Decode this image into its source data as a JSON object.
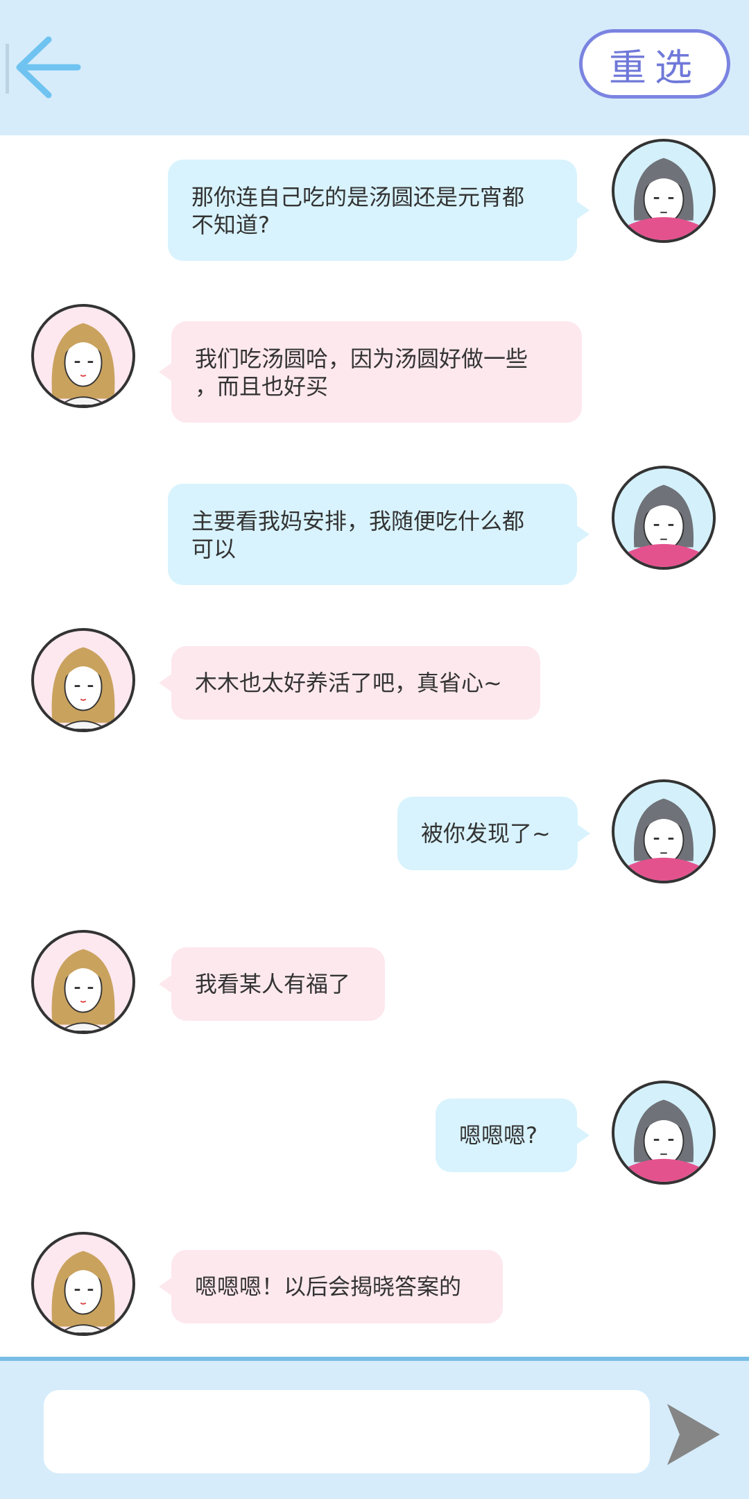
{
  "header": {
    "back_icon": "arrow-left-icon",
    "reselect_label": "重选",
    "colors": {
      "background": "#d6ecfb",
      "back_arrow": "#6fc3f0",
      "reselect": "#6f78d8"
    }
  },
  "messages": [
    {
      "side": "right",
      "lines": [
        "那你连自己吃的是汤圆还是元宵都",
        "不知道?"
      ]
    },
    {
      "side": "left",
      "lines": [
        "我们吃汤圆哈，因为汤圆好做一些",
        "，而且也好买"
      ]
    },
    {
      "side": "right",
      "lines": [
        "主要看我妈安排，我随便吃什么都",
        "可以"
      ]
    },
    {
      "side": "left",
      "lines": [
        "木木也太好养活了吧，真省心~"
      ]
    },
    {
      "side": "right",
      "lines": [
        "被你发现了~"
      ]
    },
    {
      "side": "left",
      "lines": [
        "我看某人有福了"
      ]
    },
    {
      "side": "right",
      "lines": [
        "嗯嗯嗯?"
      ]
    },
    {
      "side": "left",
      "lines": [
        "嗯嗯嗯！以后会揭晓答案的"
      ]
    }
  ],
  "composer": {
    "input_value": "",
    "input_placeholder": "",
    "send_icon": "send-icon"
  },
  "colors": {
    "bubble_right": "#d8f3fd",
    "bubble_left": "#fde8ee",
    "divider": "#79bde6",
    "text": "#333333"
  }
}
